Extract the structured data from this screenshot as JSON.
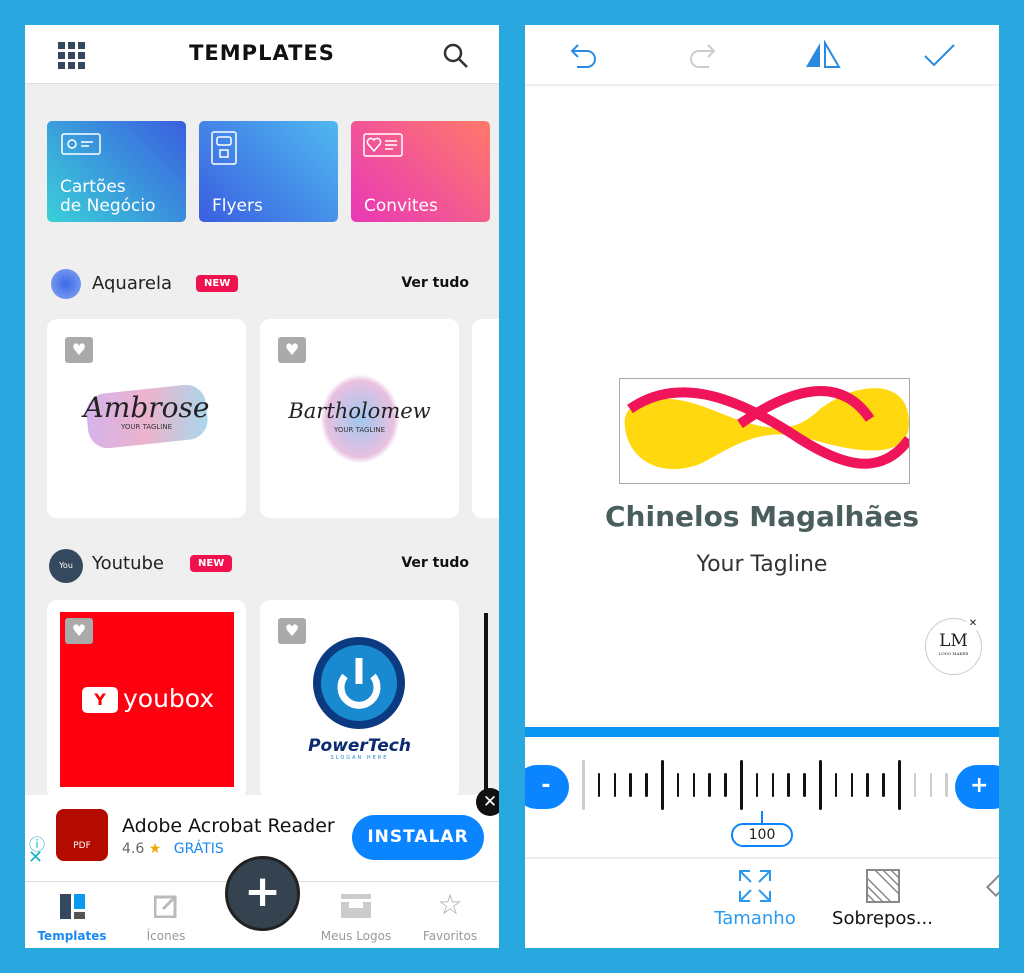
{
  "left": {
    "header": {
      "title": "TEMPLATES",
      "menu_icon": "grid-icon",
      "search_icon": "search-icon"
    },
    "categories": [
      {
        "label1": "Cartões",
        "label2": "de Negócio"
      },
      {
        "label": "Flyers"
      },
      {
        "label": "Convites"
      }
    ],
    "sections": [
      {
        "name": "Aquarela",
        "badge": "NEW",
        "more": "Ver tudo",
        "items": [
          "Ambrose",
          "Bartholomew"
        ],
        "tagline": "YOUR TAGLINE"
      },
      {
        "name": "Youtube",
        "badge": "NEW",
        "more": "Ver tudo",
        "items": [
          "youbox",
          "PowerTech"
        ],
        "slogan": "SLOGAN HERE"
      }
    ],
    "ad": {
      "app": "Adobe Acrobat Reader",
      "rating": "4.6",
      "price": "GRÁTIS",
      "button": "INSTALAR",
      "icon_text": "PDF"
    },
    "tabs": [
      {
        "label": "Templates",
        "active": true
      },
      {
        "label": "Ícones"
      },
      {
        "label": "Meus Logos"
      },
      {
        "label": "Favoritos"
      }
    ]
  },
  "right": {
    "toolbar": [
      "undo-icon",
      "redo-icon",
      "flip-icon",
      "check-icon"
    ],
    "logo": {
      "name": "Chinelos Magalhães",
      "tagline": "Your Tagline",
      "watermark": "LM",
      "watermark_sub": "LOGO MAKER"
    },
    "slider": {
      "minus": "-",
      "plus": "+",
      "value": "100"
    },
    "tools": [
      {
        "label": "Tamanho",
        "active": true
      },
      {
        "label": "Sobrepos..."
      }
    ]
  },
  "colors": {
    "accent": "#0a84ff",
    "background": "#29a8e0",
    "text_dark": "#4a5e5e"
  }
}
